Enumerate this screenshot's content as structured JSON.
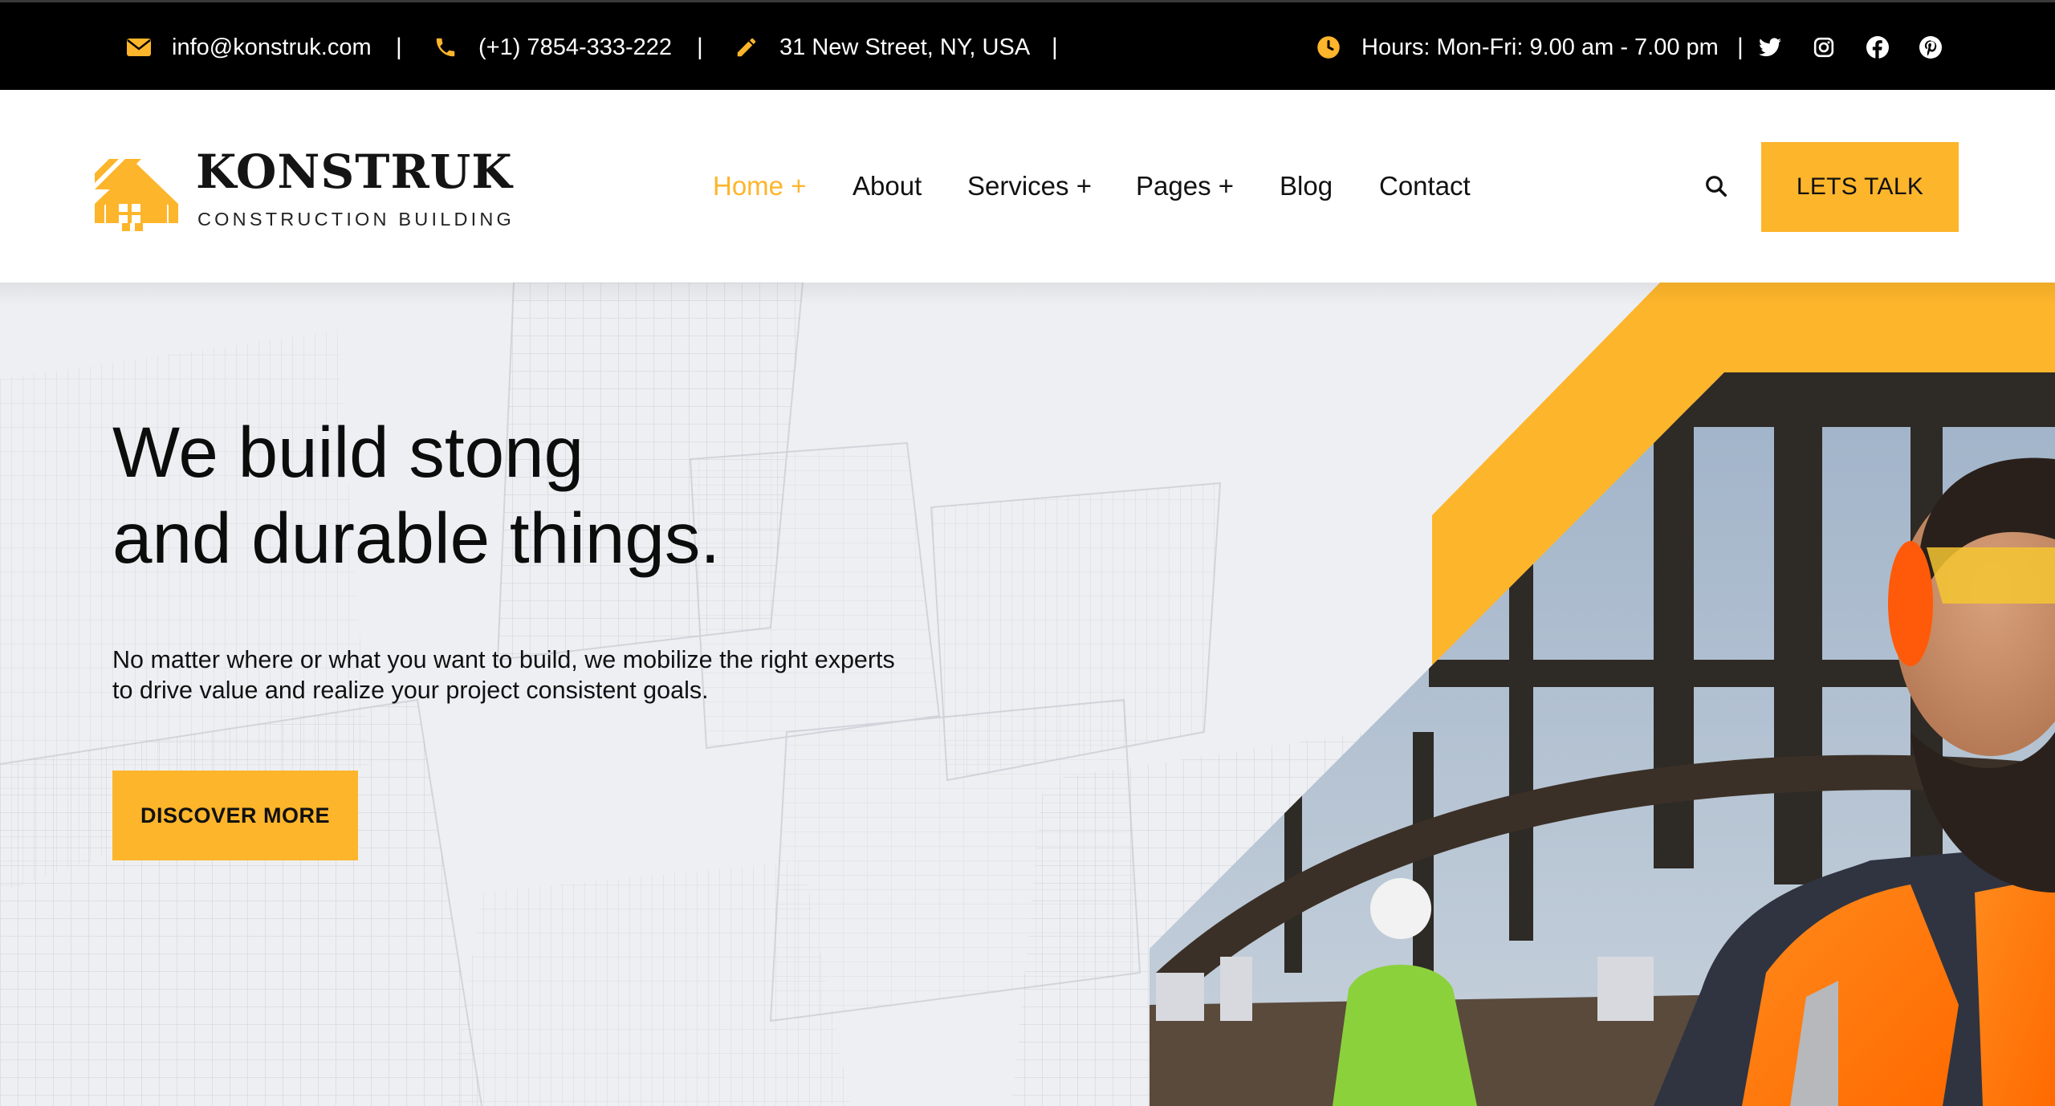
{
  "topbar": {
    "email": "info@konstruk.com",
    "phone": "(+1) 7854-333-222",
    "address": "31 New Street, NY, USA",
    "hours": "Hours: Mon-Fri: 9.00 am - 7.00 pm",
    "separator": "|",
    "icons": [
      "envelope-icon",
      "phone-icon",
      "pencil-icon",
      "clock-icon"
    ],
    "social": [
      "twitter-icon",
      "instagram-icon",
      "facebook-icon",
      "pinterest-icon"
    ]
  },
  "header": {
    "logo_name": "KONSTRUK",
    "logo_tagline": "CONSTRUCTION BUILDING",
    "nav": [
      {
        "label": "Home +",
        "active": true
      },
      {
        "label": "About",
        "active": false
      },
      {
        "label": "Services +",
        "active": false
      },
      {
        "label": "Pages +",
        "active": false
      },
      {
        "label": "Blog",
        "active": false
      },
      {
        "label": "Contact",
        "active": false
      }
    ],
    "search_icon": "search-icon",
    "cta_label": "LETS TALK"
  },
  "hero": {
    "title_lines": [
      "We build stong",
      "and durable things."
    ],
    "text_lines": [
      "No matter where or what you want to build, we mobilize the right experts",
      "to drive value and realize your project consistent goals."
    ],
    "cta_label": "DISCOVER MORE"
  },
  "colors": {
    "accent": "#fdb52b",
    "topbar_bg": "#000000",
    "hero_bg": "#eeeff2",
    "text_dark": "#0c0c0c"
  }
}
